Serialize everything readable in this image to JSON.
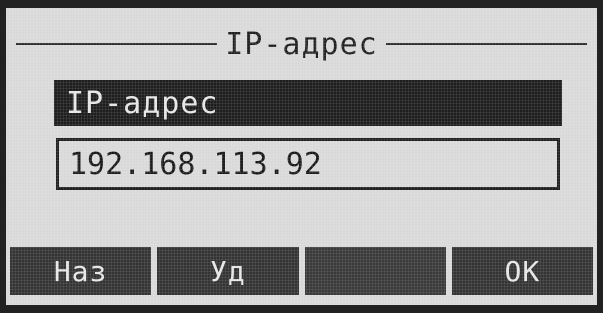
{
  "screen": {
    "title": "IP-адрес"
  },
  "field": {
    "label": "IP-адрес",
    "value": "192.168.113.92"
  },
  "softkeys": [
    {
      "label": "Наз"
    },
    {
      "label": "Уд"
    },
    {
      "label": ""
    },
    {
      "label": "ОК"
    }
  ]
}
